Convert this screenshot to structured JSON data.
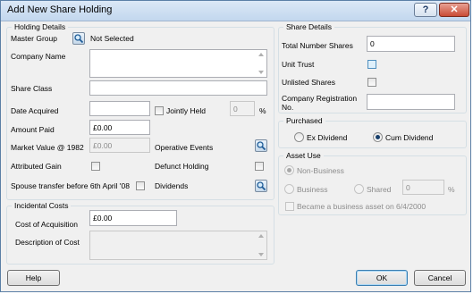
{
  "window": {
    "title": "Add New Share Holding",
    "help_glyph": "?",
    "close_glyph": "✕"
  },
  "holding_details": {
    "title": "Holding Details",
    "master_group_label": "Master Group",
    "master_group_value": "Not Selected",
    "company_name_label": "Company Name",
    "company_name_value": "",
    "share_class_label": "Share Class",
    "share_class_value": "",
    "date_acquired_label": "Date Acquired",
    "date_acquired_value": "",
    "jointly_held_label": "Jointly Held",
    "jointly_held_checked": false,
    "jointly_held_percent_value": "0",
    "percent_symbol": "%",
    "amount_paid_label": "Amount Paid",
    "amount_paid_value": "£0.00",
    "market_value_label": "Market Value @ 1982",
    "market_value_value": "£0.00",
    "operative_events_label": "Operative Events",
    "attributed_gain_label": "Attributed Gain",
    "attributed_gain_checked": false,
    "defunct_holding_label": "Defunct Holding",
    "defunct_holding_checked": false,
    "spouse_transfer_label": "Spouse transfer before 6th April '08",
    "spouse_transfer_checked": false,
    "dividends_label": "Dividends"
  },
  "incidental_costs": {
    "title": "Incidental Costs",
    "cost_of_acquisition_label": "Cost of Acquisition",
    "cost_of_acquisition_value": "£0.00",
    "description_label": "Description of Cost",
    "description_value": ""
  },
  "share_details": {
    "title": "Share Details",
    "total_shares_label": "Total Number Shares",
    "total_shares_value": "0",
    "unit_trust_label": "Unit Trust",
    "unit_trust_checked": false,
    "unlisted_shares_label": "Unlisted Shares",
    "unlisted_shares_checked": false,
    "company_reg_label_line1": "Company Registration",
    "company_reg_label_line2": "No.",
    "company_reg_value": ""
  },
  "purchased": {
    "title": "Purchased",
    "options": [
      "Ex Dividend",
      "Cum Dividend"
    ],
    "selected": "Cum Dividend"
  },
  "asset_use": {
    "title": "Asset Use",
    "non_business_label": "Non-Business",
    "business_label": "Business",
    "shared_label": "Shared",
    "shared_percent_value": "0",
    "percent_symbol": "%",
    "selected": "Non-Business",
    "business_asset_label": "Became a business asset on 6/4/2000",
    "business_asset_checked": false
  },
  "footer": {
    "help_label": "Help",
    "ok_label": "OK",
    "cancel_label": "Cancel"
  },
  "icons": {
    "search": "magnifier-icon"
  },
  "colors": {
    "dialog_bg": "#f0f0f0",
    "title_gradient_top": "#dbe8f6",
    "close_button": "#c94b35",
    "default_button_border": "#3c7fb1"
  }
}
